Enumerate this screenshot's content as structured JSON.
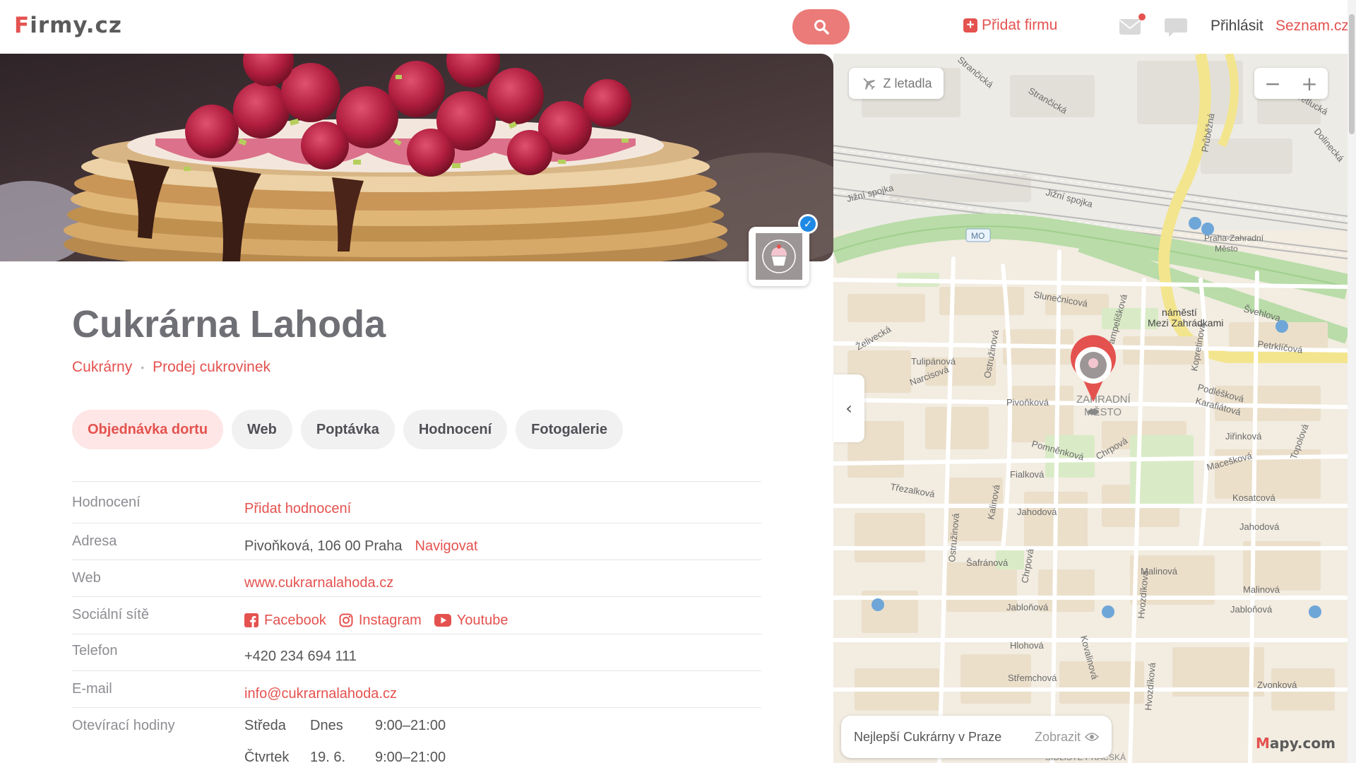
{
  "header": {
    "logo_first": "F",
    "logo_rest": "irmy.cz",
    "add_firm": "Přidat firmu",
    "login": "Přihlásit",
    "seznam": "Seznam.cz",
    "icons": [
      "search-icon",
      "mail-icon",
      "chat-icon"
    ]
  },
  "business": {
    "name": "Cukrárna Lahoda",
    "categories": [
      "Cukrárny",
      "Prodej cukrovinek"
    ],
    "verified": true
  },
  "tabs": [
    "Objednávka dortu",
    "Web",
    "Poptávka",
    "Hodnocení",
    "Fotogalerie"
  ],
  "active_tab": "Objednávka dortu",
  "info": {
    "rating_label": "Hodnocení",
    "rating_value": "Přidat hodnocení",
    "address_label": "Adresa",
    "address_value": "Pivoňková, 106 00 Praha",
    "navigate": "Navigovat",
    "web_label": "Web",
    "web_value": "www.cukrarnalahoda.cz",
    "social_label": "Sociální sítě",
    "social": [
      "Facebook",
      "Instagram",
      "Youtube"
    ],
    "phone_label": "Telefon",
    "phone_value": "+420 234 694 111",
    "email_label": "E-mail",
    "email_value": "info@cukrarnalahoda.cz",
    "hours_label": "Otevírací hodiny",
    "hours": [
      {
        "day": "Středa",
        "date": "Dnes",
        "time": "9:00–21:00"
      },
      {
        "day": "Čtvrtek",
        "date": "19. 6.",
        "time": "9:00–21:00"
      }
    ]
  },
  "map": {
    "aerial_button": "Z letadla",
    "zoom_out": "−",
    "zoom_in": "+",
    "collapse": "‹",
    "promo_text": "Nejlepší Cukrárny v Praze",
    "promo_action": "Zobrazit",
    "brand_first": "M",
    "brand_rest": "apy.com",
    "labels": {
      "strancicka": "Strančická",
      "jizni1": "Jižní spojka",
      "jizni2": "Jižní spojka",
      "mo": "MO",
      "prubezna": "Průběžná",
      "pretlucka": "Přetlucká",
      "dolinecka": "Dolinecká",
      "praha_zahradni": "Praha-Zahradní",
      "mesto_station": "Město",
      "slunecnicova": "Slunečnicová",
      "namesti1": "náměstí",
      "namesti2": "Mezi Zahrádkami",
      "svehlova": "Švehlova",
      "petrklicova": "Petrklíčová",
      "zelivecka": "Želivecká",
      "tulipanova": "Tulipánová",
      "narcisova": "Narcisová",
      "ostruzinova": "Ostružinová",
      "pampeliskova": "Pampelišková",
      "koprivova": "Kopretinová",
      "pivonkova": "Pivoňková",
      "zahradni1": "ZAHRADNÍ",
      "zahradni2": "MĚSTO",
      "podleskova": "Podléšková",
      "karafiatova": "Karafiátová",
      "jirinkova": "Jiřinková",
      "pomnenkova": "Pomněnková",
      "chrpova": "Chrpová",
      "topolova": "Topolová",
      "trezalkova": "Třezalková",
      "fialkova": "Fialková",
      "macesova": "Macešková",
      "kalinova": "Kalinová",
      "jahodova1": "Jahodová",
      "jahodova2": "Jahodová",
      "kosatcova": "Kosatcová",
      "safranova": "Šafránová",
      "malinova1": "Malinová",
      "malinova2": "Malinová",
      "jablonova1": "Jabloňová",
      "jablonova2": "Jabloňová",
      "hlohova": "Hlohová",
      "hvozdikova": "Hvozdíková",
      "kovalinova": "Kovalinová",
      "stremchova": "Střemchová",
      "zvonkova": "Zvonková",
      "sidliste": "SÍDLIŠTĚ PRAČSKÁ"
    }
  }
}
